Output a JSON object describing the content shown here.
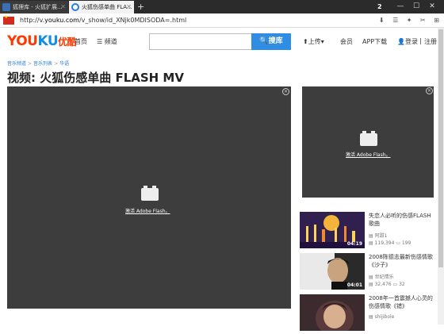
{
  "browser": {
    "tabs": [
      {
        "label": "狐狸库 - 火狐扩展..."
      },
      {
        "label": "火狐伤感单曲 FLA..."
      }
    ],
    "new_tab": "+",
    "tab_count": "2",
    "window_buttons": {
      "min": "—",
      "max": "☐",
      "close": "✕"
    },
    "url_prefix": "http://v.",
    "url_host": "youku.com",
    "url_path": "/v_show/id_XNjk0MDISODA=.html",
    "addr_icons": [
      "⬇",
      "☰",
      "✦",
      "✂",
      "⊞"
    ]
  },
  "header": {
    "logo_you": "YOU",
    "logo_ku": "KU",
    "logo_cn": "优酷",
    "nav_home": "首页",
    "nav_channel": "频道",
    "search_value": "",
    "search_button": "搜库",
    "upload": "上传",
    "member": "会员",
    "app_download": "APP下载",
    "login": "登录",
    "divider": "|",
    "register": "注册"
  },
  "breadcrumb": [
    "音乐频道",
    "音乐列表",
    "华语"
  ],
  "breadcrumb_sep": ">",
  "page_title": "视频: 火狐伤感单曲 FLASH MV",
  "main_player": {
    "close": "✕",
    "activate_flash": "激活 Adobe Flash。"
  },
  "side_player": {
    "close": "✕",
    "activate_flash": "激活 Adobe Flash。"
  },
  "related": [
    {
      "title": "失恋人必听的伤感FLASH歌曲",
      "uploader": "阿甜1",
      "plays": "119,394",
      "comments": "199",
      "duration": "04:19"
    },
    {
      "title": "2008陈德志最新伤感情歌《沙子》",
      "uploader": "世纪情乐",
      "plays": "32,476",
      "comments": "32",
      "duration": "04:01"
    },
    {
      "title": "2008年一首震撼人心灵的伤感情歌《错》",
      "uploader": "shijibole",
      "plays": "",
      "comments": "",
      "duration": ""
    }
  ],
  "colors": {
    "accent": "#2f8de4",
    "youku_red": "#ff3800",
    "youku_blue": "#0f8de8",
    "player_bg": "#3d3d3d"
  }
}
